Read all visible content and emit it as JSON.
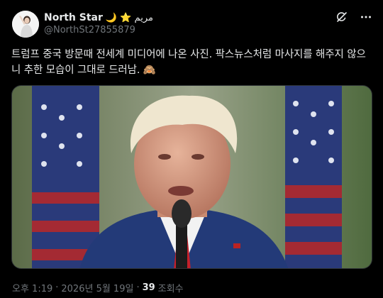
{
  "author": {
    "display_name": "North Star",
    "name_emoji": "🌙 ⭐ مريم",
    "handle": "@NorthSt27855879"
  },
  "actions": {
    "grok_icon": "grok-icon",
    "more_icon": "more-dots-icon"
  },
  "post": {
    "text": "트럼프 중국 방문때 전세계 미디어에 나온 사진.  팍스뉴스처럼 마사지를 해주지 않으니 추한 모습이 그대로 드러남. 🙈"
  },
  "media": {
    "alt": "photo"
  },
  "meta": {
    "time": "오후 1:19",
    "separator1": "·",
    "date": "2026년 5월 19일",
    "separator2": "·",
    "views_count": "39",
    "views_label": "조회수"
  },
  "colors": {
    "background": "#000000",
    "text": "#e7e9ea",
    "secondary": "#71767b",
    "border": "#2f3336"
  }
}
